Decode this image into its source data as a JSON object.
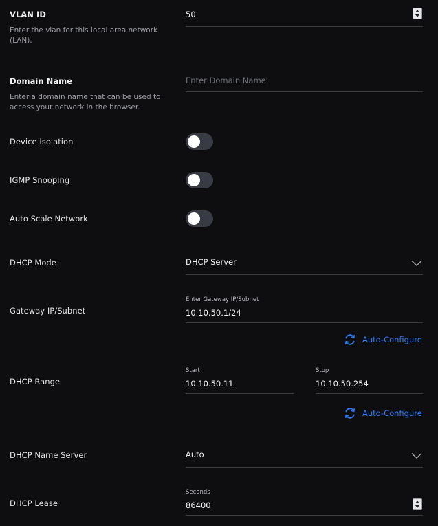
{
  "vlan": {
    "label": "VLAN ID",
    "description": "Enter the vlan for this local area network (LAN).",
    "value": "50"
  },
  "domain": {
    "label": "Domain Name",
    "description": "Enter a domain name that can be used to access your network in the browser.",
    "placeholder": "Enter Domain Name",
    "value": ""
  },
  "toggles": {
    "device_isolation": {
      "label": "Device Isolation",
      "on": false
    },
    "igmp_snooping": {
      "label": "IGMP Snooping",
      "on": false
    },
    "auto_scale": {
      "label": "Auto Scale Network",
      "on": false
    }
  },
  "dhcp_mode": {
    "label": "DHCP Mode",
    "selected": "DHCP Server",
    "icon": "chevron-down-icon"
  },
  "gateway": {
    "label": "Gateway IP/Subnet",
    "caption": "Enter Gateway IP/Subnet",
    "value": "10.10.50.1/24",
    "auto_configure": "Auto-Configure"
  },
  "dhcp_range": {
    "label": "DHCP Range",
    "start_caption": "Start",
    "start_value": "10.10.50.11",
    "stop_caption": "Stop",
    "stop_value": "10.10.50.254",
    "auto_configure": "Auto-Configure"
  },
  "name_server": {
    "label": "DHCP Name Server",
    "selected": "Auto",
    "icon": "chevron-down-icon"
  },
  "lease": {
    "label": "DHCP Lease",
    "caption": "Seconds",
    "value": "86400"
  },
  "colors": {
    "background": "#0e0e10",
    "accent": "#2d7cf6",
    "toggle_off": "#383a44"
  }
}
